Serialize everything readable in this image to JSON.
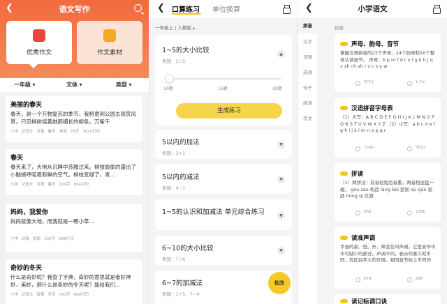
{
  "writing": {
    "title": "语文写作",
    "cards": [
      {
        "label": "优秀作文"
      },
      {
        "label": "作文素材"
      }
    ],
    "filters": [
      "一年级",
      "文体",
      "类型"
    ],
    "articles": [
      {
        "title": "美丽的春天",
        "body": "春天，是一个万物复苏的季节，我特意到公园去观赏风景。只见柳树摇着她那细长的柳条。万紫千",
        "meta": [
          "小学",
          "记叙文",
          "写景",
          "春天",
          "美丽",
          "78字",
          "3614打印"
        ]
      },
      {
        "title": "春天",
        "body": "春天来了，大地从沉睡中苏醒过来。柳枝偷偷的露出了小脑袋呼吸着新鲜的空气。柳枝变绿了，青...",
        "meta": [
          "小学",
          "记叙文",
          "写景",
          "春天",
          "109字",
          "694打印"
        ]
      },
      {
        "title": "妈妈，我爱你",
        "body": "妈妈就像大地，而我就是一颗小草...",
        "meta": [
          "小学",
          "诗歌",
          "妈妈",
          "105字",
          "586打印"
        ]
      },
      {
        "title": "奇妙的冬天",
        "body": "什么是奇妙呢？我查了字典，奇妙的意思就是者好神妙，美妙，那什么是奇妙的冬天呢？能给我们...",
        "meta": [
          "小学",
          "记叙文",
          "叙事",
          "冬天",
          "341字",
          "488打印"
        ]
      }
    ]
  },
  "oral": {
    "tabs": [
      "口算练习",
      "单位换算"
    ],
    "grade": "一年级上 | 人教版",
    "expanded": {
      "title": "1~5的大小比较",
      "sub": "例题：2○5",
      "slider_value": 10,
      "slider_labels": [
        "10题",
        "15题",
        "20题"
      ],
      "button": "生成练习"
    },
    "items": [
      {
        "title": "5以内的加法",
        "sub": "例题：3+1"
      },
      {
        "title": "5以内的减法",
        "sub": "例题：4−1"
      },
      {
        "title": "1~5的认识和加减法 单元综合练习",
        "sub": ""
      },
      {
        "title": "6~10的大小比较",
        "sub": "例题：7○6"
      },
      {
        "title": "6~7的加减法",
        "sub": "例题：1+5、7−4"
      }
    ],
    "grade_button": "批改"
  },
  "chinese": {
    "title": "小学语文",
    "sidebar": [
      "拼音",
      "汉字",
      "词语",
      "成语",
      "句子",
      "阅读",
      "作文"
    ],
    "category": "拼音",
    "lessons": [
      {
        "title": "声母、韵母、音节",
        "body": "掌握汉语拼音的23个声母、24个韵母和16个整体认读音节。 声母：b p m f d t n l g k h j q x zh ch sh r z c s y w",
        "stat1": "3712",
        "stat2": "1.7w"
      },
      {
        "title": "汉语拼音字母表",
        "body": "（1）大写：A B C D E F G H I J K L M N O P Q R S T U V W X Y Z （2）小写：a b c d e f g h i j k l m n o p q r",
        "stat1": "1543",
        "stat2": "5513"
      },
      {
        "title": "拼读",
        "body": "（1）两拼法：前音轻短后音重，两音相连猛一碰。 gòu zào 构造 lǎng bèi 狼狈 qū gǎn 驱赶 hóng qí 红旗",
        "stat1": "868",
        "stat2": "1386"
      },
      {
        "title": "读准声调",
        "body": "字音的高、低、升、降变化叫声调。它是音节中不可缺少的部分。声调不同，表示的意义就不同，有区别字义的作用。相同音节标上不同的",
        "stat1": "614",
        "stat2": "896"
      },
      {
        "title": "读记标调口诀",
        "body": "",
        "stat1": "",
        "stat2": ""
      }
    ]
  }
}
